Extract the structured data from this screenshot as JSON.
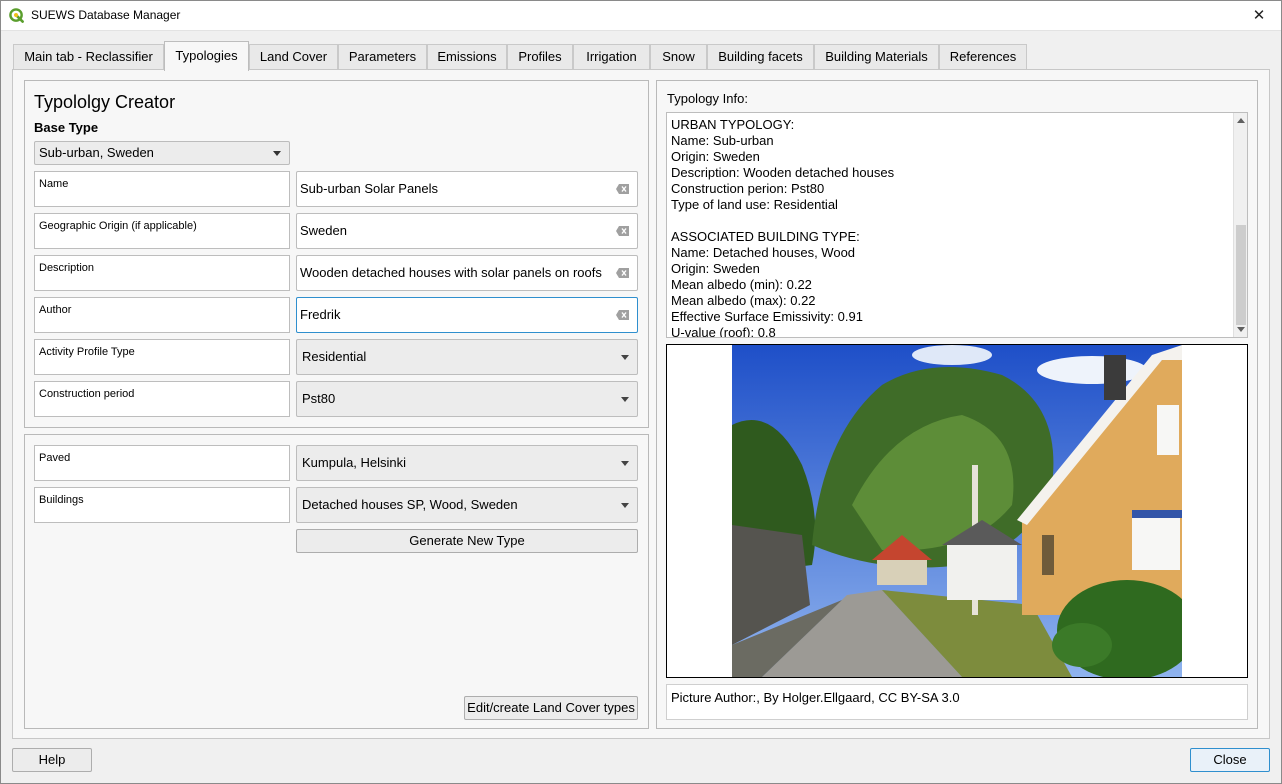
{
  "window": {
    "title": "SUEWS Database Manager",
    "close_glyph": "✕",
    "icon": "qgis-icon"
  },
  "tabs": [
    {
      "label": "Main tab - Reclassifier",
      "active": false
    },
    {
      "label": "Typologies",
      "active": true
    },
    {
      "label": "Land Cover",
      "active": false
    },
    {
      "label": "Parameters",
      "active": false
    },
    {
      "label": "Emissions",
      "active": false
    },
    {
      "label": "Profiles",
      "active": false
    },
    {
      "label": "Irrigation",
      "active": false
    },
    {
      "label": "Snow",
      "active": false
    },
    {
      "label": "Building facets",
      "active": false
    },
    {
      "label": "Building Materials",
      "active": false
    },
    {
      "label": "References",
      "active": false
    }
  ],
  "creator": {
    "heading": "Typololgy Creator",
    "base_type_label": "Base Type",
    "base_type_value": "Sub-urban, Sweden",
    "fields": [
      {
        "label": "Name",
        "value": "Sub-urban Solar Panels",
        "kind": "text"
      },
      {
        "label": "Geographic Origin (if applicable)",
        "value": "Sweden",
        "kind": "text"
      },
      {
        "label": "Description",
        "value": "Wooden detached houses with solar panels on roofs",
        "kind": "text"
      },
      {
        "label": "Author",
        "value": "Fredrik",
        "kind": "text"
      },
      {
        "label": "Activity Profile Type",
        "value": "Residential",
        "kind": "select"
      },
      {
        "label": "Construction period",
        "value": "Pst80",
        "kind": "select"
      }
    ]
  },
  "landcover": {
    "fields": [
      {
        "label": "Paved",
        "value": "Kumpula, Helsinki"
      },
      {
        "label": "Buildings",
        "value": "Detached houses SP, Wood, Sweden"
      }
    ],
    "generate_button": "Generate New Type",
    "edit_button": "Edit/create Land Cover types"
  },
  "info": {
    "label": "Typology Info:",
    "lines": [
      "URBAN TYPOLOGY:",
      "Name: Sub-urban",
      "Origin: Sweden",
      "Description: Wooden detached houses",
      "Construction perion: Pst80",
      "Type of land use: Residential",
      "",
      "ASSOCIATED BUILDING TYPE:",
      "Name: Detached houses, Wood",
      "Origin: Sweden",
      "Mean albedo (min): 0.22",
      "Mean albedo (max): 0.22",
      "Effective Surface Emissivity: 0.91",
      "U-value (roof): 0.8"
    ],
    "picture_author": "Picture Author:, By Holger.Ellgaard, CC BY-SA 3.0"
  },
  "footer": {
    "help_button": "Help",
    "close_button": "Close"
  },
  "colors": {
    "focus_border": "#2f8fce",
    "sky": "#3d6fd6",
    "house_wall": "#e0aa5c"
  }
}
